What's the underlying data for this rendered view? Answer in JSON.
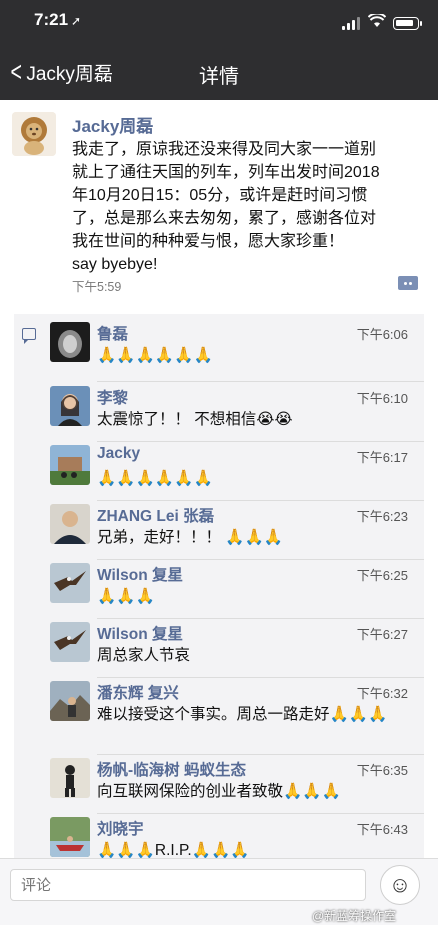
{
  "status_bar": {
    "time": "7:21"
  },
  "nav": {
    "back_label": "Jacky周磊",
    "title": "详情"
  },
  "post": {
    "author": "Jacky周磊",
    "content_lines": [
      "我走了，原谅我还没来得及同大家一一道别",
      "就上了通往天国的列车，列车出发时间2018",
      "年10月20日15：05分，或许是赶时间习惯",
      "了，总是那么来去匆匆，累了，感谢各位对",
      "我在世间的种种爱与恨，愿大家珍重！",
      "say byebye!"
    ],
    "time": "下午5:59"
  },
  "comments": [
    {
      "name": "鲁磊",
      "time": "下午6:06",
      "text": "🙏🙏🙏🙏🙏🙏"
    },
    {
      "name": "李黎",
      "time": "下午6:10",
      "text": "太震惊了！！ 不想相信😭😭"
    },
    {
      "name": "Jacky",
      "time": "下午6:17",
      "text": "🙏🙏🙏🙏🙏🙏"
    },
    {
      "name": "ZHANG Lei 张磊",
      "time": "下午6:23",
      "text": "兄弟，走好！！！ 🙏🙏🙏"
    },
    {
      "name": "Wilson 复星",
      "time": "下午6:25",
      "text": "🙏🙏🙏"
    },
    {
      "name": "Wilson 复星",
      "time": "下午6:27",
      "text": "周总家人节哀"
    },
    {
      "name": "潘东辉 复兴",
      "time": "下午6:32",
      "text": "难以接受这个事实。周总一路走好🙏🙏🙏"
    },
    {
      "name": "杨帆-临海树 蚂蚁生态",
      "time": "下午6:35",
      "text": "向互联网保险的创业者致敬🙏🙏🙏"
    },
    {
      "name": "刘晓宇",
      "time": "下午6:43",
      "text": "🙏🙏🙏R.I.P.🙏🙏🙏"
    }
  ],
  "input": {
    "placeholder": "评论"
  },
  "watermark": "@新蓝筹操作室",
  "colors": {
    "nav_bg": "#2e2e30",
    "link": "#576b95",
    "comment_bg": "#f3f3f5"
  }
}
